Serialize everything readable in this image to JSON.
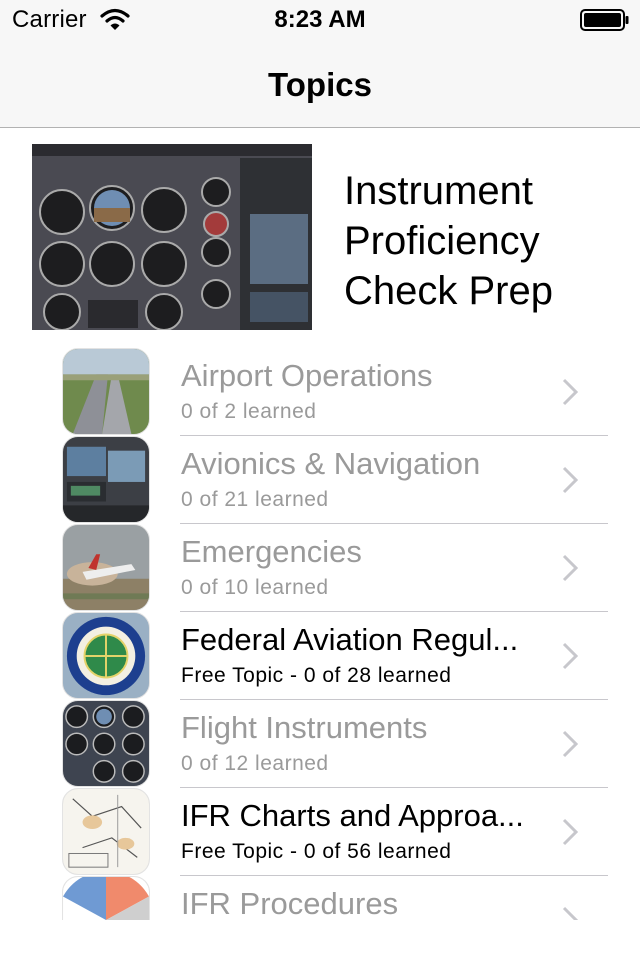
{
  "status_bar": {
    "carrier": "Carrier",
    "time": "8:23 AM"
  },
  "nav": {
    "title": "Topics"
  },
  "header": {
    "title": "Instrument Proficiency Check Prep",
    "image_icon": "cockpit-panel-photo"
  },
  "topics": [
    {
      "title": "Airport Operations",
      "subtitle": "0 of 2 learned",
      "state": "locked",
      "icon": "runway-photo"
    },
    {
      "title": "Avionics & Navigation",
      "subtitle": "0 of 21 learned",
      "state": "locked",
      "icon": "avionics-photo"
    },
    {
      "title": "Emergencies",
      "subtitle": "0 of 10 learned",
      "state": "locked",
      "icon": "emergency-landing-photo"
    },
    {
      "title": "Federal Aviation Regul...",
      "subtitle": "Free Topic - 0 of 28 learned",
      "state": "free",
      "icon": "faa-seal"
    },
    {
      "title": "Flight Instruments",
      "subtitle": "0 of 12 learned",
      "state": "locked",
      "icon": "instruments-photo"
    },
    {
      "title": "IFR Charts and Approa...",
      "subtitle": "Free Topic - 0 of 56 learned",
      "state": "free",
      "icon": "chart-map"
    },
    {
      "title": "IFR Procedures",
      "subtitle": "",
      "state": "locked",
      "icon": "holding-pattern-diagram"
    }
  ],
  "colors": {
    "locked_text": "#9a9a9a",
    "free_text": "#000000",
    "bar_bg": "#f7f7f7",
    "chevron": "#c7c7cc"
  }
}
